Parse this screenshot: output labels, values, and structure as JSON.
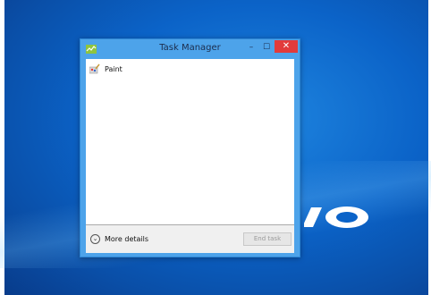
{
  "window": {
    "title": "Task Manager",
    "minimize_glyph": "–",
    "maximize_glyph": "☐",
    "close_glyph": "✕"
  },
  "processes": [
    {
      "name": "Paint",
      "icon": "paint-icon"
    }
  ],
  "footer": {
    "more_details_label": "More details",
    "end_task_label": "End task"
  },
  "colors": {
    "desktop": "#0b63c8",
    "window_frame": "#4da3ea",
    "close_button": "#e23b3b"
  }
}
